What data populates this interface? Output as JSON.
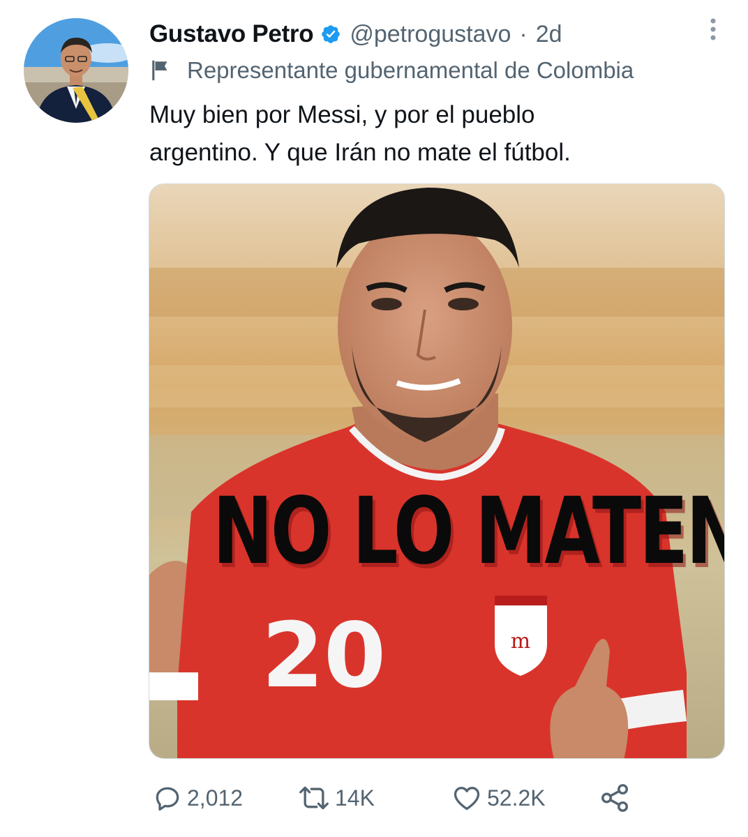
{
  "author": {
    "display_name": "Gustavo Petro",
    "handle": "@petrogustavo",
    "separator": "·",
    "time": "2d",
    "label": "Representante gubernamental de Colombia"
  },
  "tweet": {
    "lines": [
      "Muy bien por Messi, y por el pueblo",
      "argentino. Y que Irán no mate el fútbol."
    ]
  },
  "media": {
    "overlay_text": "NO LO MATEN",
    "jersey_number": "20"
  },
  "actions": {
    "reply_count": "2,012",
    "retweet_count": "14K",
    "like_count": "52.2K"
  },
  "colors": {
    "verified": "#1d9bf0",
    "secondary_text": "#536471",
    "primary_text": "#0f1419",
    "jersey_red": "#d9342b"
  },
  "icons": {
    "verified": "verified-badge-icon",
    "more": "more-vertical-icon",
    "label": "flag-icon",
    "reply": "reply-icon",
    "retweet": "retweet-icon",
    "like": "heart-icon",
    "share": "share-icon"
  }
}
